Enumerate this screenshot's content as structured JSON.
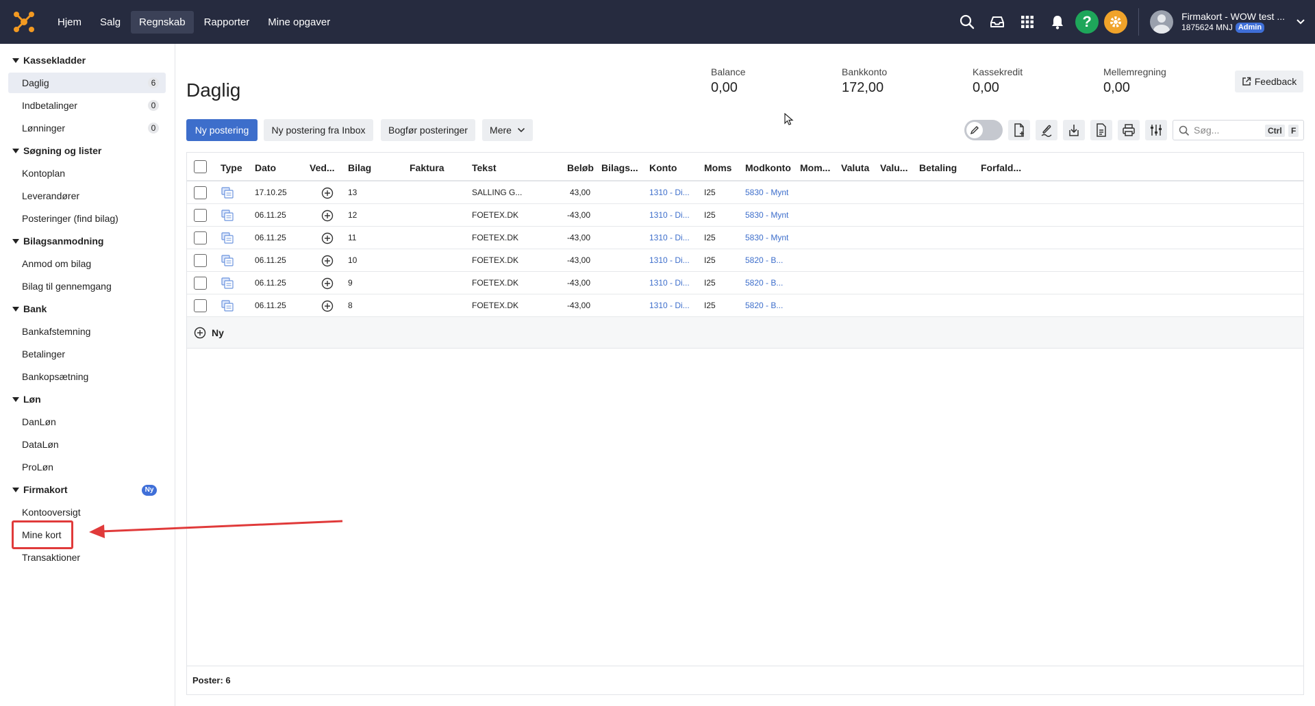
{
  "app": {
    "nav": [
      "Hjem",
      "Salg",
      "Regnskab",
      "Rapporter",
      "Mine opgaver"
    ],
    "active_nav": "Regnskab",
    "help_glyph": "?",
    "user": {
      "name": "Firmakort - WOW test ...",
      "sub": "1875624 MNJ",
      "role": "Admin"
    }
  },
  "sidebar": {
    "sections": [
      {
        "title": "Kassekladder",
        "items": [
          {
            "label": "Daglig",
            "count": "6",
            "active": true
          },
          {
            "label": "Indbetalinger",
            "count": "0"
          },
          {
            "label": "Lønninger",
            "count": "0"
          }
        ]
      },
      {
        "title": "Søgning og lister",
        "items": [
          {
            "label": "Kontoplan"
          },
          {
            "label": "Leverandører"
          },
          {
            "label": "Posteringer (find bilag)"
          }
        ]
      },
      {
        "title": "Bilagsanmodning",
        "items": [
          {
            "label": "Anmod om bilag"
          },
          {
            "label": "Bilag til gennemgang"
          }
        ]
      },
      {
        "title": "Bank",
        "items": [
          {
            "label": "Bankafstemning"
          },
          {
            "label": "Betalinger"
          },
          {
            "label": "Bankopsætning"
          }
        ]
      },
      {
        "title": "Løn",
        "items": [
          {
            "label": "DanLøn"
          },
          {
            "label": "DataLøn"
          },
          {
            "label": "ProLøn"
          }
        ]
      },
      {
        "title": "Firmakort",
        "badge": "Ny",
        "items": [
          {
            "label": "Kontooversigt"
          },
          {
            "label": "Mine kort"
          },
          {
            "label": "Transaktioner"
          }
        ]
      }
    ]
  },
  "page": {
    "title": "Daglig",
    "stats": [
      {
        "label": "Balance",
        "value": "0,00"
      },
      {
        "label": "Bankkonto",
        "value": "172,00"
      },
      {
        "label": "Kassekredit",
        "value": "0,00"
      },
      {
        "label": "Mellemregning",
        "value": "0,00"
      }
    ],
    "feedback": "Feedback"
  },
  "toolbar": {
    "new_entry": "Ny postering",
    "new_from_inbox": "Ny postering fra Inbox",
    "post_entries": "Bogfør posteringer",
    "more": "Mere",
    "search_placeholder": "Søg...",
    "kbd_ctrl": "Ctrl",
    "kbd_f": "F"
  },
  "table": {
    "headers": [
      "Type",
      "Dato",
      "Ved...",
      "Bilag",
      "Faktura",
      "Tekst",
      "Beløb",
      "Bilags...",
      "Konto",
      "Moms",
      "Modkonto",
      "Mom...",
      "Valuta",
      "Valu...",
      "Betaling",
      "Forfald..."
    ],
    "rows": [
      {
        "dato": "17.10.25",
        "bilag": "13",
        "tekst": "SALLING G...",
        "belob": "43,00",
        "konto": "1310 - Di...",
        "moms": "I25",
        "modkonto": "5830 - Mynt"
      },
      {
        "dato": "06.11.25",
        "bilag": "12",
        "tekst": "FOETEX.DK",
        "belob": "-43,00",
        "konto": "1310 - Di...",
        "moms": "I25",
        "modkonto": "5830 - Mynt"
      },
      {
        "dato": "06.11.25",
        "bilag": "11",
        "tekst": "FOETEX.DK",
        "belob": "-43,00",
        "konto": "1310 - Di...",
        "moms": "I25",
        "modkonto": "5830 - Mynt"
      },
      {
        "dato": "06.11.25",
        "bilag": "10",
        "tekst": "FOETEX.DK",
        "belob": "-43,00",
        "konto": "1310 - Di...",
        "moms": "I25",
        "modkonto": "5820 - B..."
      },
      {
        "dato": "06.11.25",
        "bilag": "9",
        "tekst": "FOETEX.DK",
        "belob": "-43,00",
        "konto": "1310 - Di...",
        "moms": "I25",
        "modkonto": "5820 - B..."
      },
      {
        "dato": "06.11.25",
        "bilag": "8",
        "tekst": "FOETEX.DK",
        "belob": "-43,00",
        "konto": "1310 - Di...",
        "moms": "I25",
        "modkonto": "5820 - B..."
      }
    ],
    "new_row_label": "Ny",
    "footer": "Poster: 6"
  },
  "colors": {
    "topbar": "#262b3f",
    "primary": "#3d6ecb",
    "help_green": "#1ea65a",
    "settings_orange": "#f0a32a",
    "annotation_red": "#e03a3a"
  },
  "icons": [
    "search-icon",
    "inbox-icon",
    "apps-grid-icon",
    "bell-icon",
    "help-icon",
    "settings-icon",
    "chevron-down-icon",
    "pencil-icon",
    "new-document-icon",
    "attach-icon",
    "download-icon",
    "export-icon",
    "print-icon",
    "columns-settings-icon",
    "document-type-icon",
    "add-circle-icon",
    "external-link-icon"
  ]
}
